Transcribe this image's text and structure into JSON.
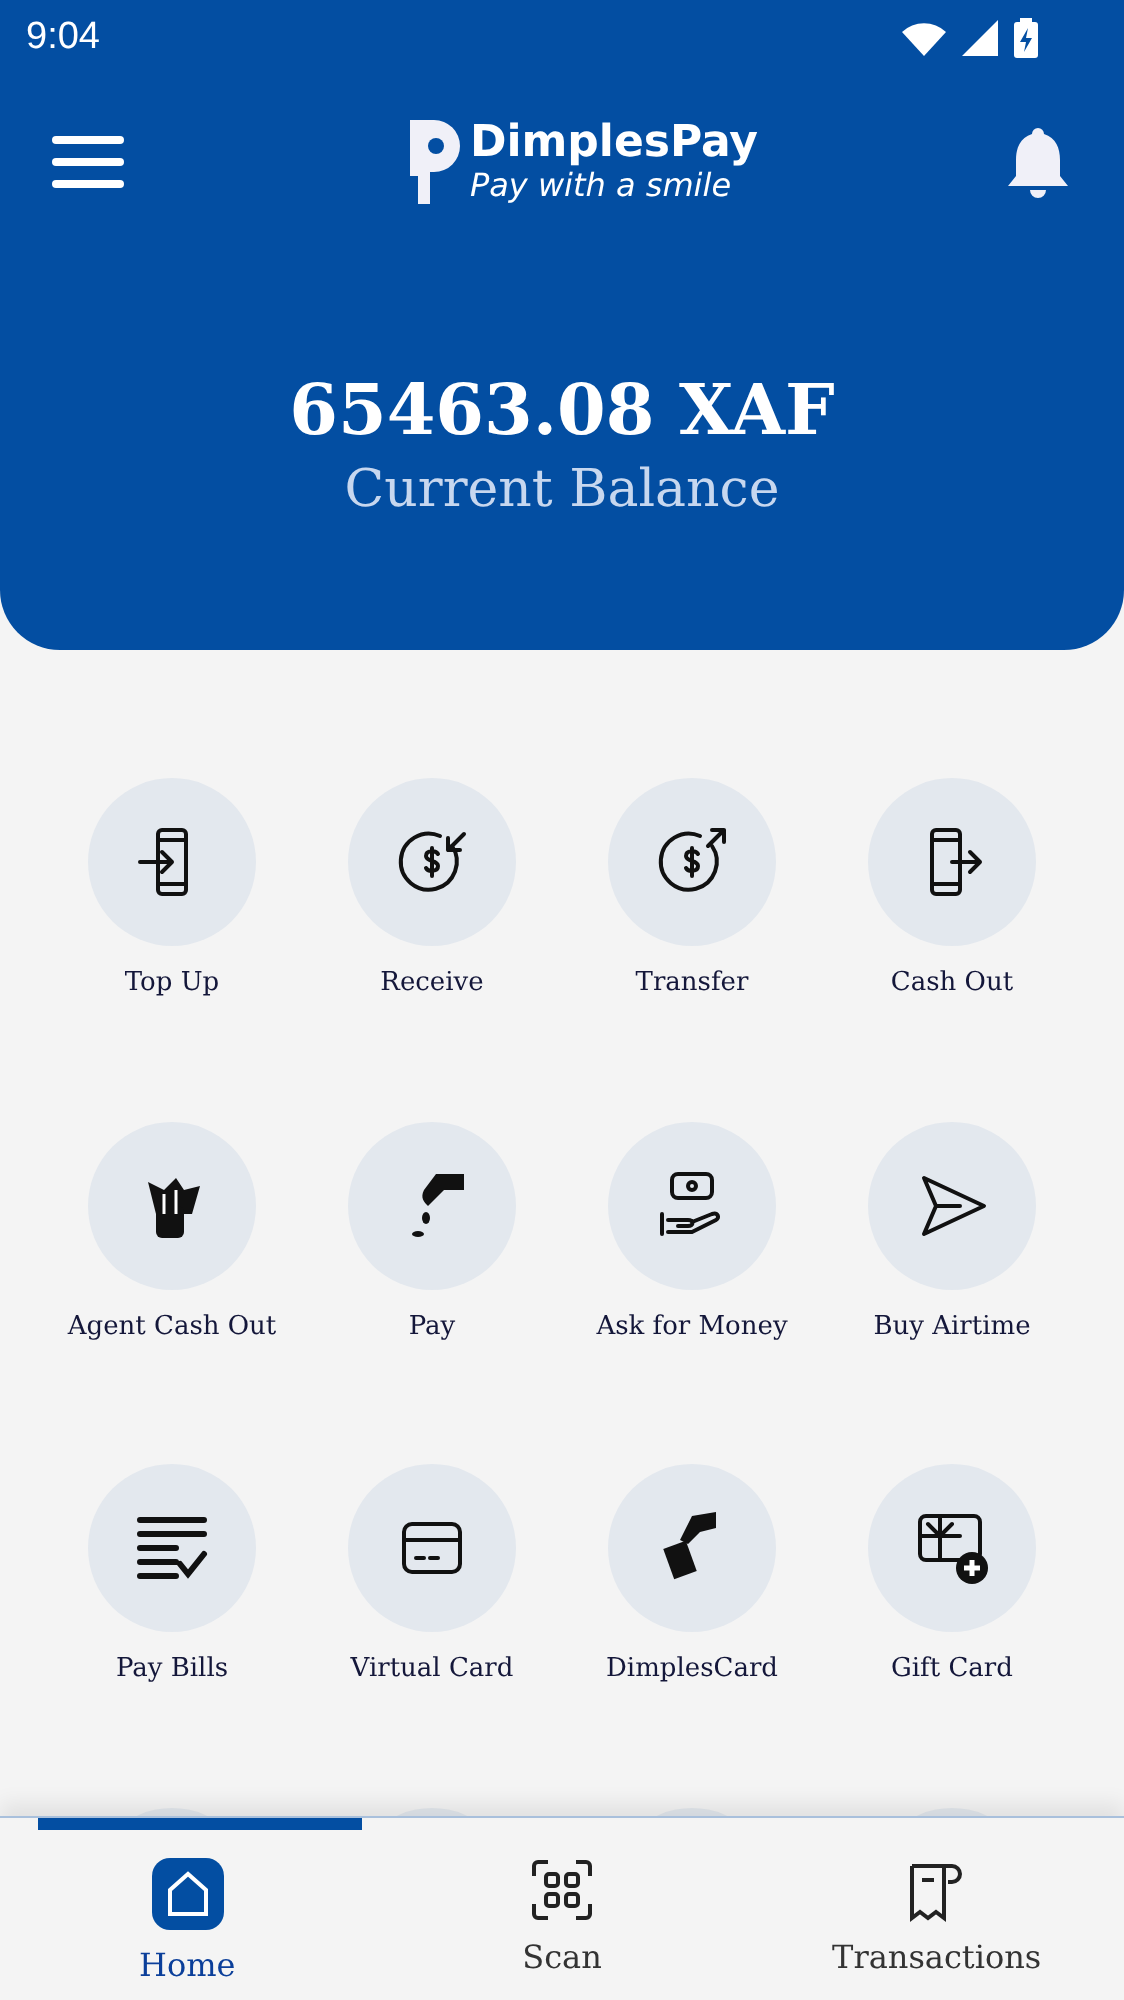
{
  "status_bar": {
    "time": "9:04"
  },
  "header": {
    "brand": "DimplesPay",
    "tagline": "Pay with a smile"
  },
  "balance": {
    "amount": "65463.08 XAF",
    "label": "Current Balance"
  },
  "actions": [
    {
      "label": "Top Up"
    },
    {
      "label": "Receive"
    },
    {
      "label": "Transfer"
    },
    {
      "label": "Cash Out"
    },
    {
      "label": "Agent Cash Out"
    },
    {
      "label": "Pay"
    },
    {
      "label": "Ask for Money"
    },
    {
      "label": "Buy Airtime"
    },
    {
      "label": "Pay Bills"
    },
    {
      "label": "Virtual Card"
    },
    {
      "label": "DimplesCard"
    },
    {
      "label": "Gift Card"
    }
  ],
  "bottom_nav": [
    {
      "label": "Home",
      "selected": true
    },
    {
      "label": "Scan",
      "selected": false
    },
    {
      "label": "Transactions",
      "selected": false
    }
  ]
}
